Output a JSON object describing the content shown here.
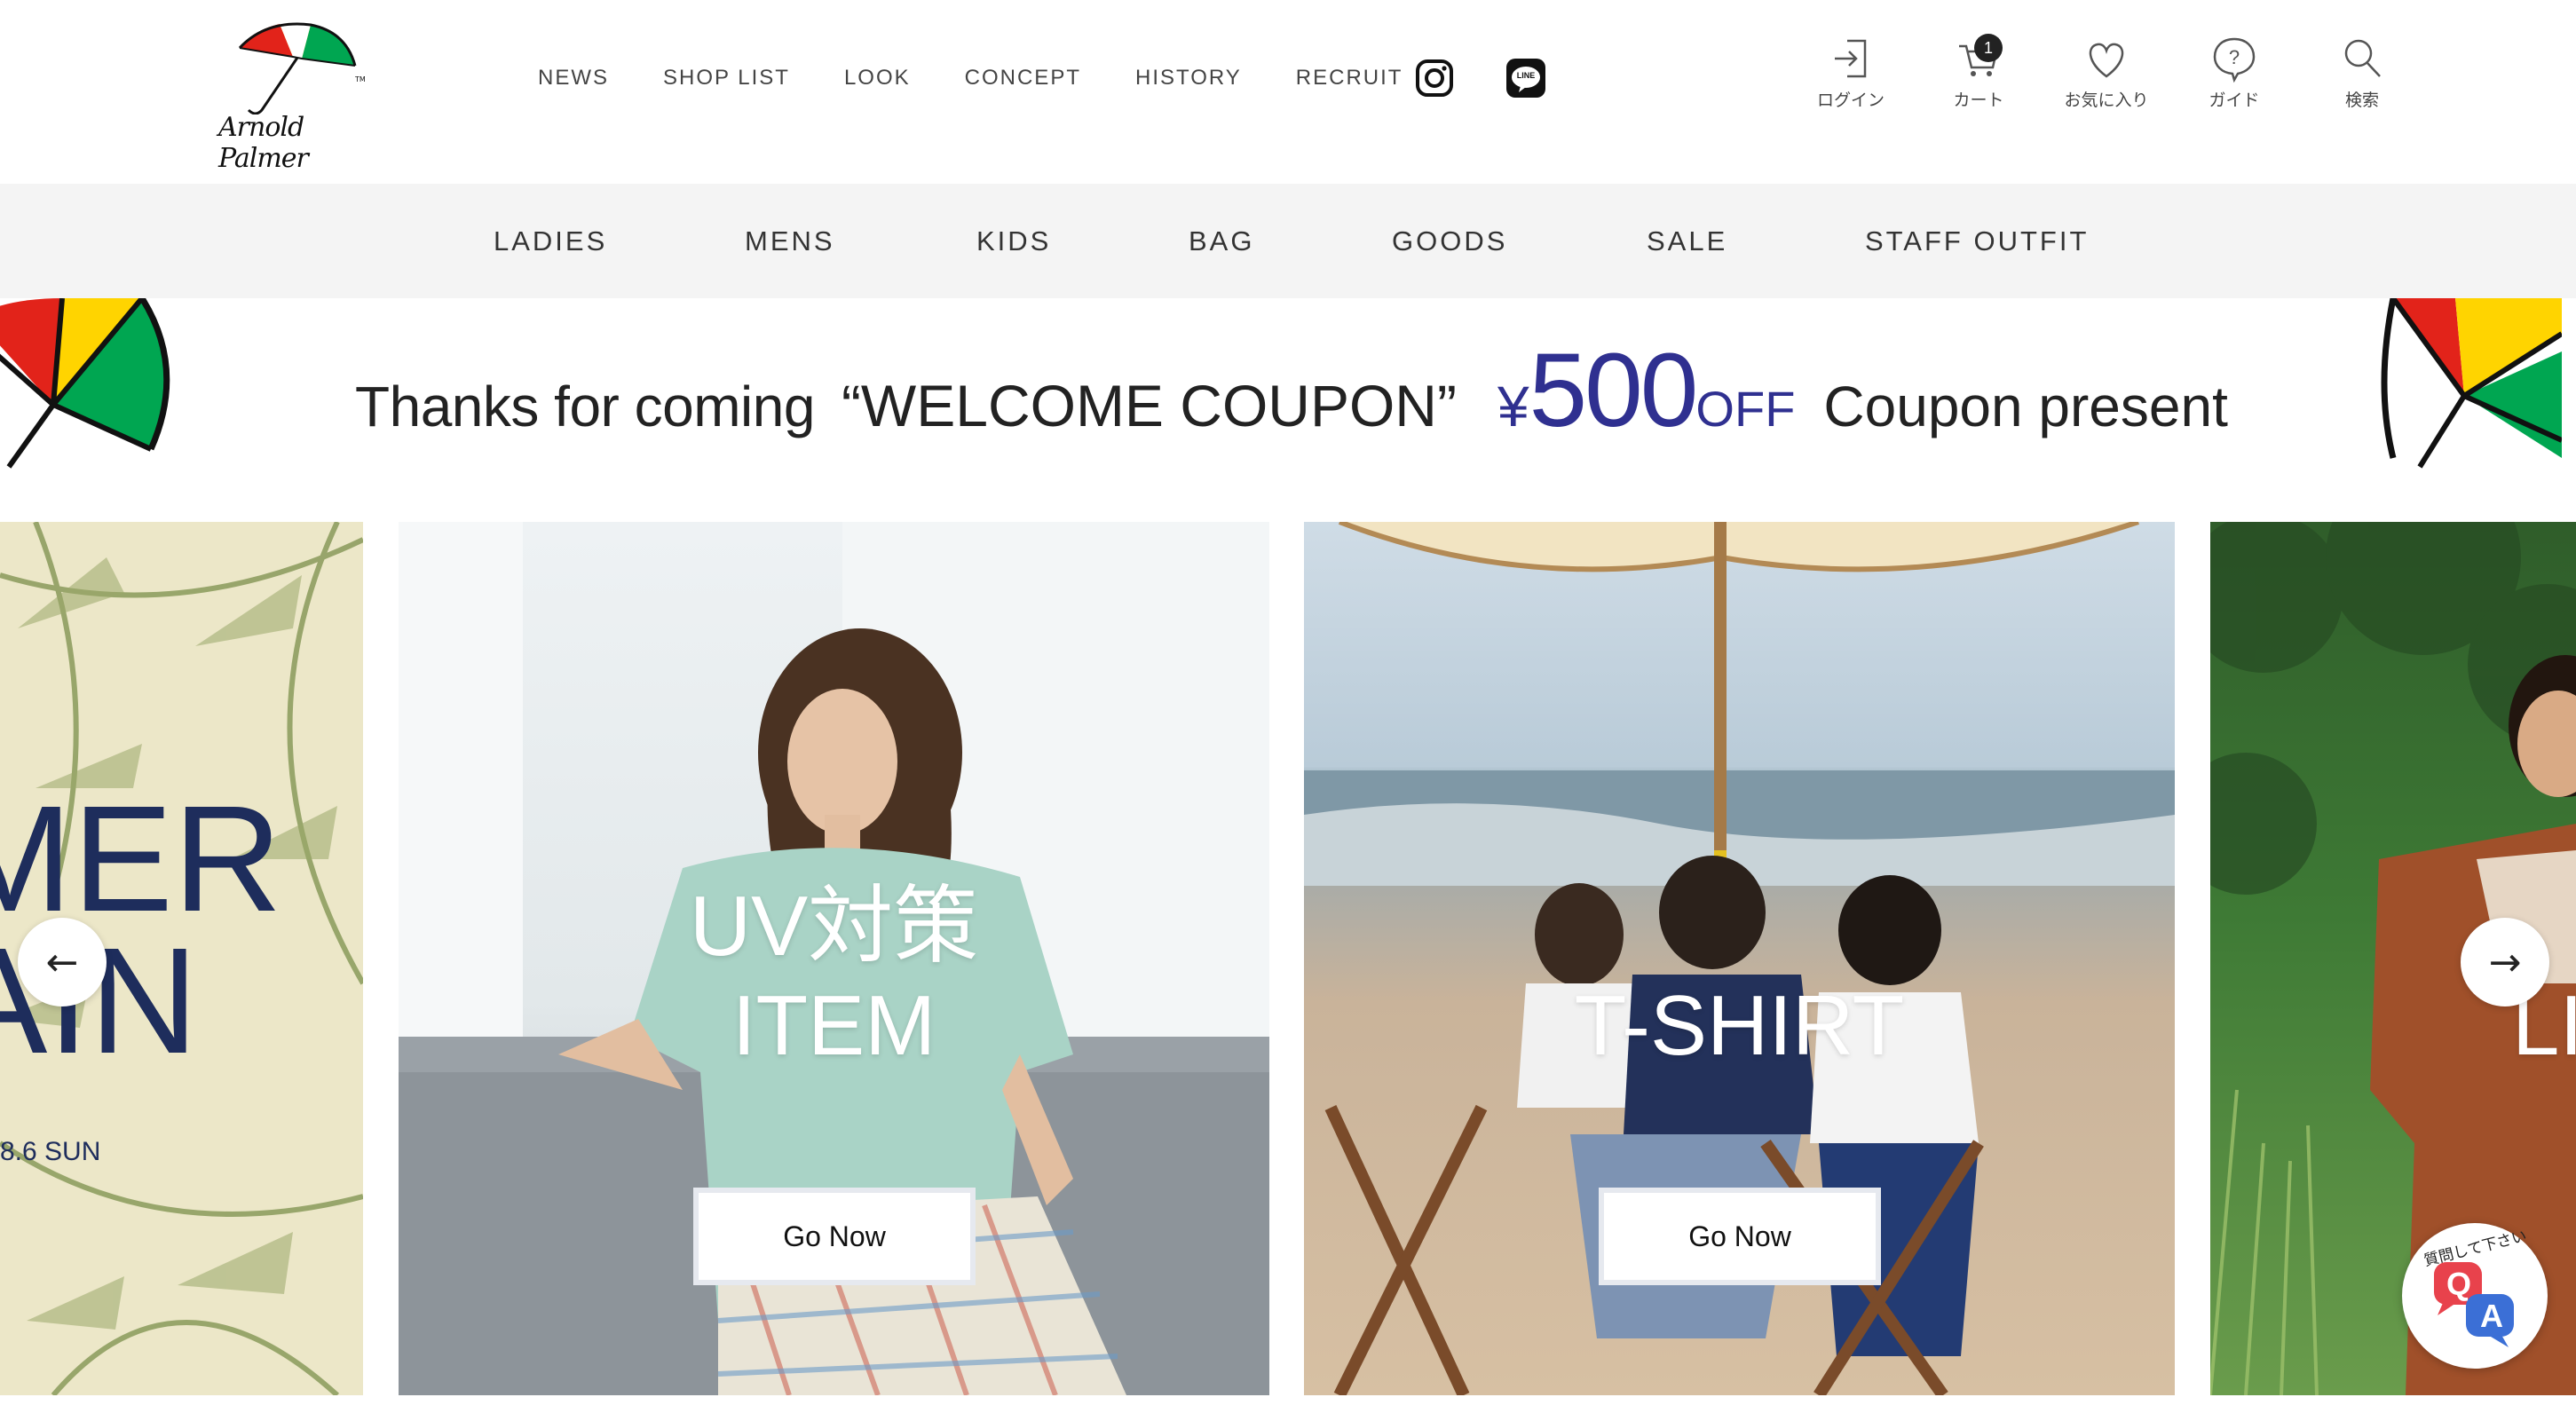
{
  "brand": {
    "logo_name": "umbrella-logo",
    "logo_text": "Arnold Palmer",
    "colors": {
      "red": "#e2231a",
      "yellow": "#ffd400",
      "green": "#00a651",
      "navy": "#2f3090"
    }
  },
  "topnav": {
    "items": [
      {
        "label": "NEWS"
      },
      {
        "label": "SHOP LIST"
      },
      {
        "label": "LOOK"
      },
      {
        "label": "CONCEPT"
      },
      {
        "label": "HISTORY"
      },
      {
        "label": "RECRUIT"
      }
    ],
    "sns": [
      {
        "icon": "instagram-icon"
      },
      {
        "icon": "line-icon",
        "label": "LINE"
      }
    ]
  },
  "utils": {
    "login": {
      "label": "ログイン",
      "icon": "login-icon"
    },
    "cart": {
      "label": "カート",
      "icon": "cart-icon",
      "count": "1"
    },
    "favorites": {
      "label": "お気に入り",
      "icon": "heart-icon"
    },
    "guide": {
      "label": "ガイド",
      "icon": "help-icon"
    },
    "search": {
      "label": "検索",
      "icon": "search-icon"
    }
  },
  "categories": [
    {
      "label": "LADIES"
    },
    {
      "label": "MENS"
    },
    {
      "label": "KIDS"
    },
    {
      "label": "BAG"
    },
    {
      "label": "GOODS"
    },
    {
      "label": "SALE"
    },
    {
      "label": "STAFF OUTFIT"
    }
  ],
  "coupon": {
    "lead": "Thanks for coming",
    "name": "“WELCOME COUPON”",
    "yen": "¥",
    "amount": "500",
    "off": "OFF",
    "tail": "Coupon present"
  },
  "slides": [
    {
      "title_line1": "MER",
      "title_line2": "AIN",
      "date": "8.6 SUN"
    },
    {
      "title_line1": "UV対策",
      "title_line2": "ITEM",
      "cta": "Go Now"
    },
    {
      "title_line1": "T-SHIRT",
      "cta": "Go Now"
    },
    {
      "title_line1": "LI"
    }
  ],
  "slider_controls": {
    "prev": "←",
    "next": "→"
  },
  "qa_widget": {
    "caption": "質問して下さい",
    "q": "Q",
    "a": "A"
  }
}
